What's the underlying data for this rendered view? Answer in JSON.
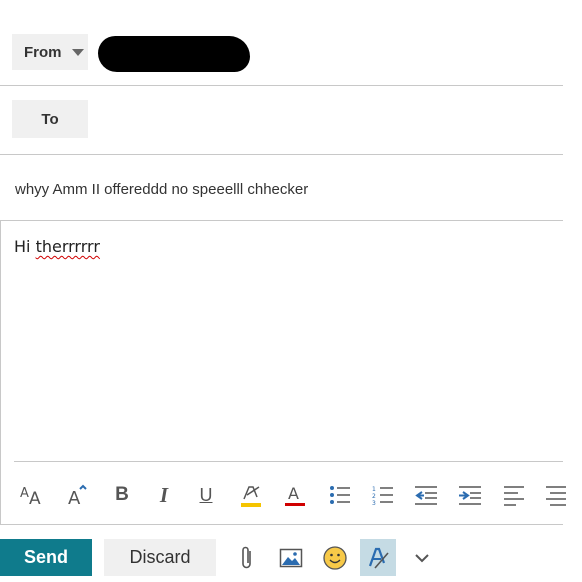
{
  "header": {
    "from_label": "From",
    "to_label": "To"
  },
  "subject": "whyy Amm II offereddd no speeelll chhecker",
  "body": {
    "word1": "Hi",
    "word2": "therrrrrr"
  },
  "format_toolbar": {
    "icons": [
      "font-size-icon",
      "grow-font-icon",
      "bold-icon",
      "italic-icon",
      "underline-icon",
      "highlight-icon",
      "font-color-icon",
      "bullets-icon",
      "numbering-icon",
      "decrease-indent-icon",
      "increase-indent-icon",
      "align-left-icon",
      "align-center-icon"
    ],
    "bold": "B",
    "italic": "I",
    "underline": "U"
  },
  "actions": {
    "send_label": "Send",
    "discard_label": "Discard",
    "icons": [
      "attach-icon",
      "insert-picture-icon",
      "emoji-icon",
      "formatting-options-icon",
      "more-chevron-icon"
    ]
  },
  "colors": {
    "accent": "#0f7b8c",
    "button_bg": "#f0f0f0",
    "active_bg": "#c5dbe4",
    "icon_blue": "#2b6cb0",
    "highlight_yellow": "#f5c400",
    "font_red": "#d00000",
    "emoji_yellow": "#f7c948"
  }
}
